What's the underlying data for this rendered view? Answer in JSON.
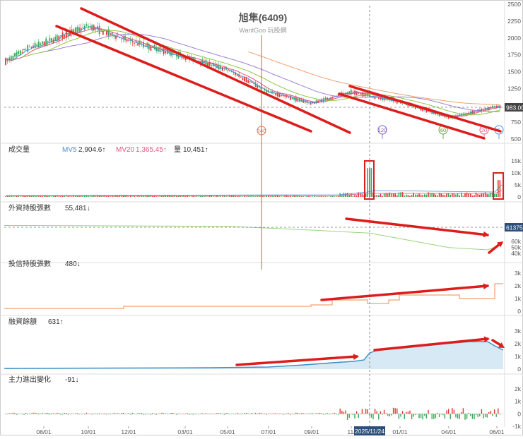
{
  "header": {
    "title": "旭隼(6409)",
    "watermark": "WantGoo 玩股網"
  },
  "panels": {
    "price": {
      "y_ticks": [
        "2500",
        "2250",
        "2000",
        "1750",
        "1500",
        "1250",
        "1000",
        "750",
        "500"
      ],
      "last_price_label": "983.00",
      "markers": [
        {
          "label": "240",
          "color": "#e07a3a"
        },
        {
          "label": "120",
          "color": "#7b5cc4"
        },
        {
          "label": "60",
          "color": "#5aa02c"
        },
        {
          "label": "20",
          "color": "#e0557f"
        },
        {
          "label": "5",
          "color": "#4a8fd6"
        }
      ]
    },
    "volume": {
      "title": "成交量",
      "mv5_label": "MV5",
      "mv5_value": "2,904.6↑",
      "mv20_label": "MV20",
      "mv20_value": "1,365.45↑",
      "qty_label": "量",
      "qty_value": "10,451↑",
      "y_ticks": [
        "15k",
        "10k",
        "5k",
        "0"
      ]
    },
    "foreign": {
      "title": "外資持股張數",
      "value": "55,481↓",
      "y_ticks": [
        "60k",
        "50k",
        "40k"
      ],
      "last_label": "61375"
    },
    "trust": {
      "title": "投信持股張數",
      "value": "480↓",
      "y_ticks": [
        "3k",
        "2k",
        "1k",
        "0"
      ]
    },
    "margin": {
      "title": "融資餘額",
      "value": "631↑",
      "y_ticks": [
        "3k",
        "2k",
        "1k",
        "0"
      ]
    },
    "main_force": {
      "title": "主力進出變化",
      "value": "-91↓",
      "y_ticks": [
        "2k",
        "1k",
        "0",
        "-1k"
      ]
    }
  },
  "x_axis": {
    "ticks": [
      "08/01",
      "10/01",
      "12/01",
      "03/01",
      "05/01",
      "07/01",
      "09/01",
      "11/",
      "01/01",
      "04/01",
      "06/01"
    ],
    "cursor_label": "2025/11/24"
  },
  "colors": {
    "up": "#e3342f",
    "down": "#34a853",
    "ma5": "#4a8fd6",
    "ma20": "#e0557f",
    "ma60": "#8cc63f",
    "ma120": "#9b7fd4",
    "ma240": "#f0a070",
    "trend_annotation": "#dd1c1c",
    "foreign_line": "#9bd47c",
    "trust_line": "#f0a070",
    "margin_line": "#3d8ec2",
    "margin_fill": "#d6e9f4"
  },
  "chart_data": {
    "type": "candlestick",
    "series_summary": {
      "price": {
        "x": [
          "08/01",
          "10/01",
          "12/01",
          "03/01",
          "05/01",
          "07/01",
          "09/01",
          "11/24",
          "01/01",
          "04/01",
          "06/01"
        ],
        "close": [
          1920,
          2180,
          1960,
          1720,
          1530,
          1200,
          1030,
          1200,
          1050,
          820,
          983
        ],
        "ylim": [
          500,
          2500
        ]
      },
      "volume": {
        "ylim": [
          0,
          15000
        ],
        "spikes": [
          {
            "x": "11/24",
            "value": 12000
          },
          {
            "x": "06/01",
            "value": 7000
          }
        ]
      },
      "foreign_holdings": {
        "ylim": [
          40000,
          65000
        ],
        "x": [
          "08/01",
          "05/01",
          "09/01",
          "11/24",
          "04/01",
          "06/01"
        ],
        "values": [
          60000,
          59000,
          57000,
          55500,
          45000,
          48000
        ]
      },
      "trust_holdings": {
        "ylim": [
          0,
          3000
        ],
        "x": [
          "08/01",
          "12/01",
          "09/01",
          "11/24",
          "01/01",
          "04/01",
          "06/01"
        ],
        "values": [
          150,
          400,
          500,
          1200,
          1800,
          1900,
          2400
        ]
      },
      "margin_balance": {
        "ylim": [
          0,
          3000
        ],
        "x": [
          "08/01",
          "09/01",
          "11/24",
          "01/01",
          "04/01",
          "06/01"
        ],
        "values": [
          100,
          500,
          800,
          1600,
          2200,
          1700
        ]
      },
      "main_force": {
        "ylim": [
          -1000,
          2000
        ]
      }
    }
  }
}
